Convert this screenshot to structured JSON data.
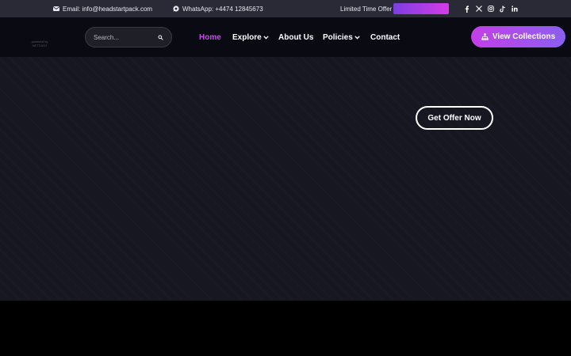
{
  "topbar": {
    "email": "Email: info@headstartpack.com",
    "whatsapp": "WhatsApp: +4474 12845673",
    "offer_label": "Limited Time Offer",
    "offer_button_color": "#b03ee6",
    "social_icons": [
      "facebook-icon",
      "x-icon",
      "instagram-icon",
      "tiktok-icon",
      "linkedin-icon"
    ]
  },
  "header": {
    "logo_line1": "powered by",
    "logo_line2": "NETCAST",
    "search_placeholder": "Search...",
    "nav": {
      "home": "Home",
      "explore": "Explore",
      "about": "About Us",
      "policies": "Policies",
      "contact": "Contact"
    },
    "cta_label": "View Collections",
    "accent_color": "#c94bf0"
  },
  "hero": {
    "button_label": "Get Offer Now"
  }
}
